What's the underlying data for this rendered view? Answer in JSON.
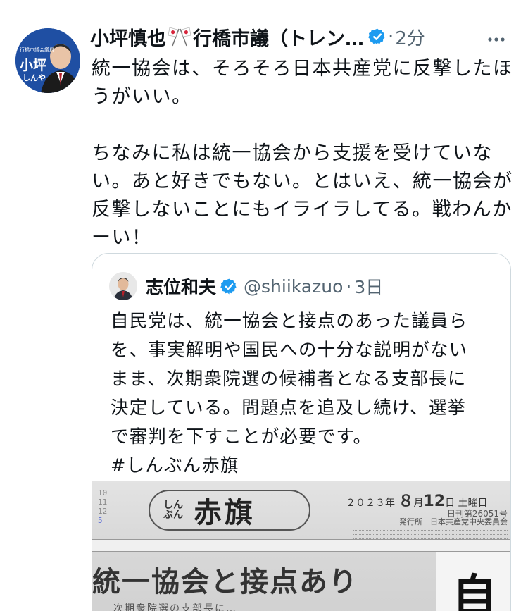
{
  "tweet": {
    "author_name": "小坪慎也",
    "author_title": "行橋市議（トレン…",
    "time": "2分",
    "avatar_caption_top": "行橋市議会議員",
    "avatar_caption_name": "小坪",
    "avatar_caption_kana": "しんや",
    "lines": [
      "統一協会は、そろそろ日本共産党に反撃したほ",
      "うがいい。"
    ],
    "lines2": [
      "ちなみに私は統一協会から支援を受けていな",
      "い。あと好きでもない。とはいえ、統一協会が",
      "反撃しないことにもイライラしてる。戦わんか",
      "ーい！"
    ]
  },
  "quote": {
    "author_name": "志位和夫",
    "handle": "@shiikazuo",
    "time": "3日",
    "lines": [
      "自民党は、統一協会と接点のあった議員ら",
      "を、事実解明や国民への十分な説明がない",
      "まま、次期衆院選の候補者となる支部長に",
      "決定している。問題点を追及し続け、選挙",
      "で審判を下すことが必要です。",
      "#しんぶん赤旗"
    ],
    "image": {
      "calendar": [
        "10",
        "11",
        "12",
        "5"
      ],
      "mast_small": "しんぶん",
      "mast_big": "赤旗",
      "date_prefix": "２０２３年",
      "date_month": "８",
      "date_day": "12",
      "date_suffix": "土曜日",
      "issue": "日刊第26051号",
      "publisher": "発行所　日本共産党中央委員会",
      "headline": "統一協会と接点あり",
      "big_char": "自",
      "subline": "次期衆院選の支部長に…"
    }
  },
  "colors": {
    "verified": "#1d9bf0",
    "secondary_text": "#536471",
    "border": "#cfd9de"
  },
  "icons": {
    "verified": "verified-badge-icon",
    "more": "more-horizontal-icon",
    "flags": "crossed-japan-flags-icon"
  }
}
